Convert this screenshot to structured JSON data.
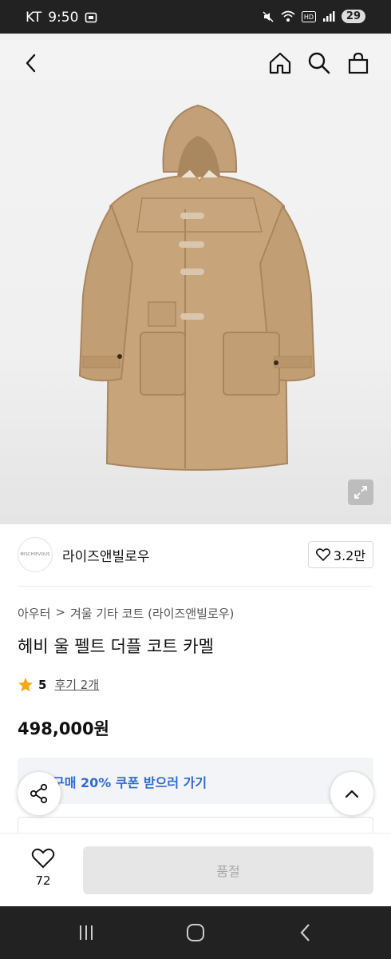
{
  "status_bar": {
    "carrier": "KT",
    "time": "9:50",
    "battery": "29"
  },
  "icons": {
    "back": "chevron-left-icon",
    "home": "home-icon",
    "search": "search-icon",
    "cart": "bag-icon",
    "expand": "expand-icon",
    "heart": "heart-icon",
    "star": "star-icon",
    "share": "share-icon",
    "scroll_top": "chevron-up-icon"
  },
  "colors": {
    "accent_blue": "#2f6bd1",
    "star": "#f4a815",
    "disabled_bg": "#e6e6e6",
    "coat": "#c8a47a"
  },
  "brand": {
    "logo_text": "MISCHIEVOUS",
    "name": "라이즈앤빌로우",
    "likes": "3.2만"
  },
  "breadcrumb": {
    "category": "아우터",
    "separator": ">",
    "subcategory": "겨울 기타 코트 (라이즈앤빌로우)"
  },
  "product": {
    "title": "헤비 울 펠트 더플 코트 카멜",
    "rating": "5",
    "reviews": "후기 2개",
    "price": "498,000원"
  },
  "coupon": {
    "text": "구매 20% 쿠폰 받으러 가기"
  },
  "bottom": {
    "wish_count": "72",
    "buy_label": "품절"
  }
}
